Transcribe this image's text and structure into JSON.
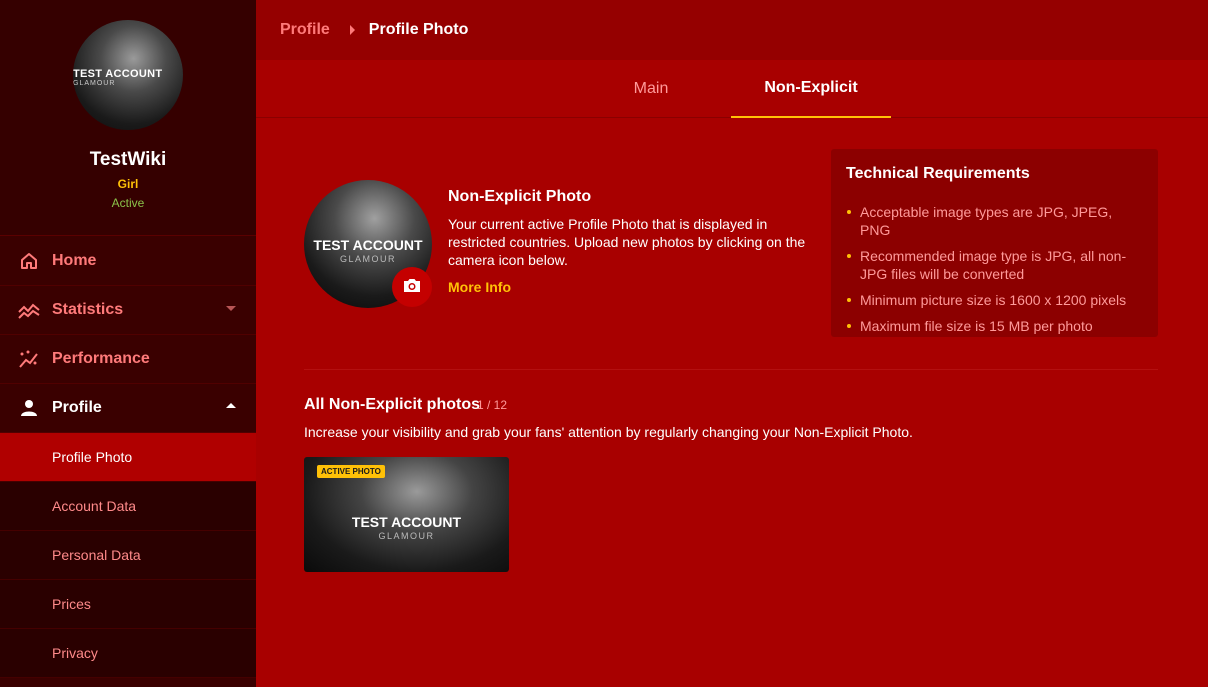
{
  "user": {
    "avatar_watermark": "TEST ACCOUNT",
    "avatar_watermark_sub": "GLAMOUR",
    "name": "TestWiki",
    "type": "Girl",
    "status": "Active"
  },
  "nav": {
    "home": "Home",
    "statistics": "Statistics",
    "performance": "Performance",
    "profile": "Profile",
    "sub": [
      "Profile Photo",
      "Account Data",
      "Personal Data",
      "Prices",
      "Privacy"
    ]
  },
  "breadcrumb": {
    "parent": "Profile",
    "current": "Profile Photo"
  },
  "tabs": [
    "Main",
    "Non-Explicit"
  ],
  "photo": {
    "watermark": "TEST ACCOUNT",
    "watermark_sub": "GLAMOUR",
    "title": "Non-Explicit Photo",
    "description": "Your current active Profile Photo that is displayed in restricted countries. Upload new photos by clicking on the camera icon below.",
    "more_info": "More Info"
  },
  "tech": {
    "title": "Technical Requirements",
    "items": [
      "Acceptable image types are JPG, JPEG, PNG",
      "Recommended image type is JPG, all non-JPG files will be converted",
      "Minimum picture size is 1600 x 1200 pixels",
      "Maximum file size is 15 MB per photo"
    ]
  },
  "gallery": {
    "title": "All Non-Explicit photos",
    "count": "1 / 12",
    "description": "Increase your visibility and grab your fans' attention by regularly changing your Non-Explicit Photo.",
    "thumb_badge": "ACTIVE PHOTO",
    "thumb_watermark": "TEST ACCOUNT",
    "thumb_watermark_sub": "GLAMOUR"
  },
  "colors": {
    "accent": "#ffc107",
    "background": "#a80000",
    "sidebar": "#3a0000",
    "status_active": "#8bc34a"
  }
}
